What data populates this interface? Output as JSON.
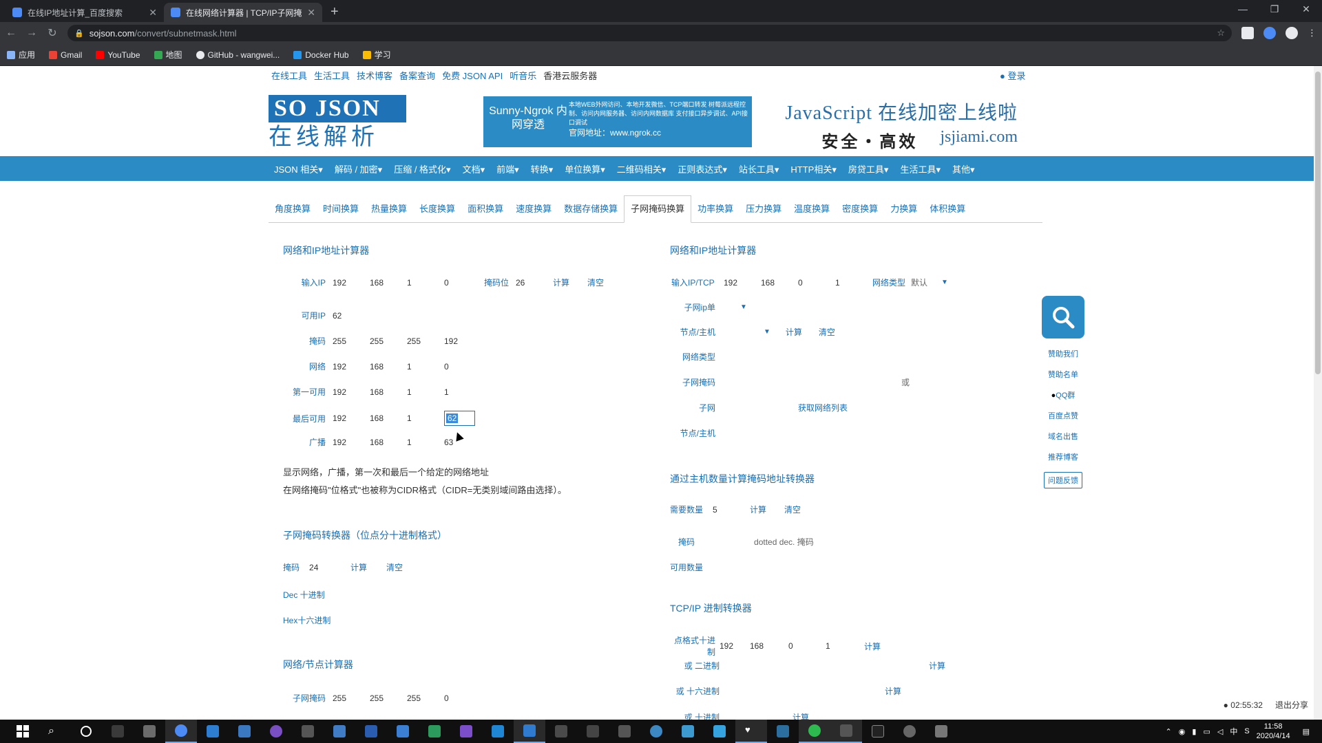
{
  "browser": {
    "tabs": [
      {
        "title": "在线IP地址计算_百度搜索",
        "active": false
      },
      {
        "title": "在线网络计算器 | TCP/IP子网掩...",
        "active": true
      }
    ],
    "url_host": "sojson.com",
    "url_path": "/convert/subnetmask.html",
    "bookmarks": [
      "应用",
      "Gmail",
      "YouTube",
      "地图",
      "GitHub - wangwei...",
      "Docker Hub",
      "学习"
    ]
  },
  "site": {
    "top_links": [
      "在线工具",
      "生活工具",
      "技术博客",
      "备案查询",
      "免费 JSON API",
      "听音乐",
      "香港云服务器"
    ],
    "login": "登录",
    "logo_line1": "SO JSON",
    "logo_line2": "在线解析",
    "banner1_title": "Sunny-Ngrok 内网穿透",
    "banner1_text": "本地WEB外网访问、本地开发微信、TCP端口转发 树莓派远程控制、访问内网服务器、访问内网数据库 支付接口异步调试、API接口调试",
    "banner1_url": "官网地址：www.ngrok.cc",
    "banner2_line1": "JavaScript 在线加密上线啦",
    "banner2_cn": "安全・高效",
    "banner2_url": "jsjiami.com",
    "main_nav": [
      "JSON 相关",
      "解码 / 加密",
      "压缩 / 格式化",
      "文档",
      "前端",
      "转换",
      "单位换算",
      "二维码相关",
      "正则表达式",
      "站长工具",
      "HTTP相关",
      "房贷工具",
      "生活工具",
      "其他"
    ],
    "tabs": [
      "角度换算",
      "时间换算",
      "热量换算",
      "长度换算",
      "面积换算",
      "速度换算",
      "数据存储换算",
      "子网掩码换算",
      "功率换算",
      "压力换算",
      "温度换算",
      "密度换算",
      "力换算",
      "体积换算"
    ],
    "active_tab_index": 7
  },
  "left": {
    "calc1_title": "网络和IP地址计算器",
    "input_ip_label": "输入IP",
    "input_ip": [
      "192",
      "168",
      "1",
      "0"
    ],
    "mask_bits_label": "掩码位",
    "mask_bits": "26",
    "calc_label": "计算",
    "clear_label": "清空",
    "available_label": "可用IP",
    "available": "62",
    "rows": [
      {
        "label": "掩码",
        "values": [
          "255",
          "255",
          "255",
          "192"
        ]
      },
      {
        "label": "网络",
        "values": [
          "192",
          "168",
          "1",
          "0"
        ]
      },
      {
        "label": "第一可用",
        "values": [
          "192",
          "168",
          "1",
          "1"
        ]
      },
      {
        "label": "最后可用",
        "values": [
          "192",
          "168",
          "1",
          "62"
        ]
      },
      {
        "label": "广播",
        "values": [
          "192",
          "168",
          "1",
          "63"
        ]
      }
    ],
    "desc1": "显示网络，广播，第一次和最后一个给定的网络地址",
    "desc2": "在网络掩码\"位格式\"也被称为CIDR格式（CIDR=无类别域间路由选择）。",
    "calc2_title": "子网掩码转换器（位点分十进制格式）",
    "mask_label": "掩码",
    "mask_value": "24",
    "dec_label": "Dec 十进制",
    "hex_label": "Hex十六进制",
    "calc3_title": "网络/节点计算器",
    "subnet_mask_label": "子网掩码",
    "subnet_mask": [
      "255",
      "255",
      "255",
      "0"
    ]
  },
  "right": {
    "calc1_title": "网络和IP地址计算器",
    "input_label": "输入IP/TCP",
    "input_ip": [
      "192",
      "168",
      "0",
      "1"
    ],
    "net_type_label": "网络类型",
    "net_type_value": "默认",
    "subnet_ip_label": "子网ip单",
    "node_host_label": "节点/主机",
    "calc_label": "计算",
    "clear_label": "清空",
    "net_class_label": "网络类型",
    "subnet_mask_label": "子网掩码",
    "or_label": "或",
    "subnet_label": "子网",
    "get_list_label": "获取网络列表",
    "node_host2_label": "节点/主机",
    "calc2_title": "通过主机数量计算掩码地址转换器",
    "need_count_label": "需要数量",
    "need_count": "5",
    "mask_label": "掩码",
    "dotted_label": "dotted dec. 掩码",
    "usable_label": "可用数量",
    "calc3_title": "TCP/IP 进制转换器",
    "dotted_dec_label": "点格式十进制",
    "dotted_dec": [
      "192",
      "168",
      "0",
      "1"
    ],
    "binary_label": "或 二进制",
    "hex_label": "或 十六进制",
    "partial_label": "或 十进制"
  },
  "sidebar": [
    "赞助我们",
    "赞助名单",
    "QQ群",
    "百度点赞",
    "域名出售",
    "推荐博客",
    "问题反馈"
  ],
  "recording": {
    "time": "02:55:32",
    "share": "退出分享"
  },
  "clock": {
    "time": "11:58",
    "date": "2020/4/14"
  }
}
